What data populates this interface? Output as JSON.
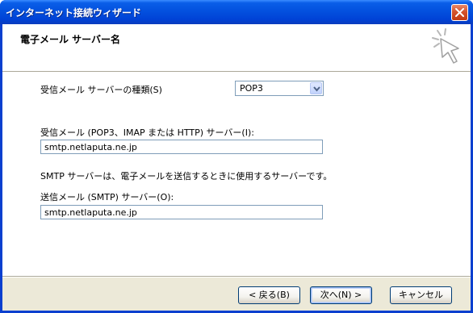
{
  "window": {
    "title": "インターネット接続ウィザード"
  },
  "header": {
    "title": "電子メール サーバー名",
    "icon": "wizard-sparkle-icon"
  },
  "form": {
    "server_type_label": "受信メール サーバーの種類(S)",
    "server_type_value": "POP3",
    "incoming_label": "受信メール (POP3、IMAP または HTTP) サーバー(I):",
    "incoming_value": "smtp.netlaputa.ne.jp",
    "smtp_note": "SMTP サーバーは、電子メールを送信するときに使用するサーバーです。",
    "outgoing_label": "送信メール (SMTP) サーバー(O):",
    "outgoing_value": "smtp.netlaputa.ne.jp"
  },
  "buttons": {
    "back": "< 戻る(B)",
    "next": "次へ(N) >",
    "cancel": "キャンセル"
  },
  "colors": {
    "titlebar": "#0453e0",
    "dialog_bg": "#ece9d8",
    "field_border": "#7f9db9"
  }
}
